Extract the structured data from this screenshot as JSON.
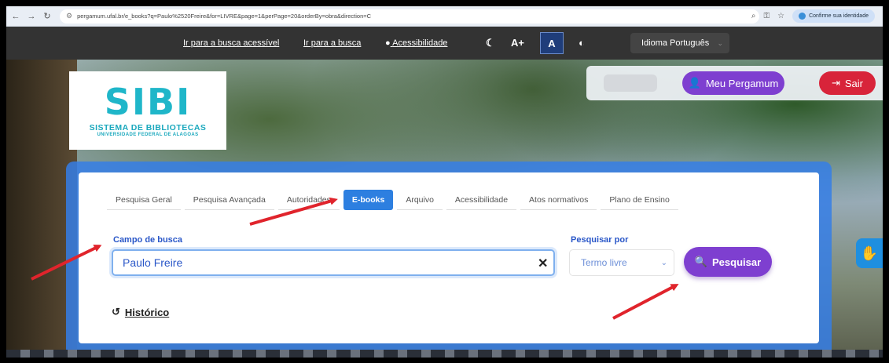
{
  "browser": {
    "url": "pergamum.ufal.br/e_books?q=Paulo%2520Freire&for=LIVRE&page=1&perPage=20&orderBy=obra&direction=C",
    "identity_label": "Confirme sua identidade"
  },
  "accessibility_bar": {
    "link_accessible_search": "Ir para a busca acessível",
    "link_search": "Ir para a busca",
    "accessibility_label": "Acessibilidade",
    "font_increase": "A+",
    "font_normal": "A",
    "language_label": "Idioma Português"
  },
  "logo": {
    "mark": "SIBI",
    "line1": "SISTEMA DE BIBLIOTECAS",
    "line2": "UNIVERSIDADE FEDERAL DE ALAGOAS"
  },
  "user": {
    "meu_pergamum": "Meu Pergamum",
    "sair": "Sair"
  },
  "search": {
    "tabs": [
      {
        "label": "Pesquisa Geral"
      },
      {
        "label": "Pesquisa Avançada"
      },
      {
        "label": "Autoridades"
      },
      {
        "label": "E-books"
      },
      {
        "label": "Arquivo"
      },
      {
        "label": "Acessibilidade"
      },
      {
        "label": "Atos normativos"
      },
      {
        "label": "Plano de Ensino"
      }
    ],
    "field_label": "Campo de busca",
    "field_value": "Paulo Freire",
    "search_by_label": "Pesquisar por",
    "search_by_value": "Termo livre",
    "search_button": "Pesquisar",
    "history_link": "Histórico"
  },
  "colors": {
    "accent_purple": "#7e3fd0",
    "tab_active_blue": "#2d7fe0",
    "logout_red": "#d8243a",
    "annotation_arrow_red": "#e0242c"
  }
}
